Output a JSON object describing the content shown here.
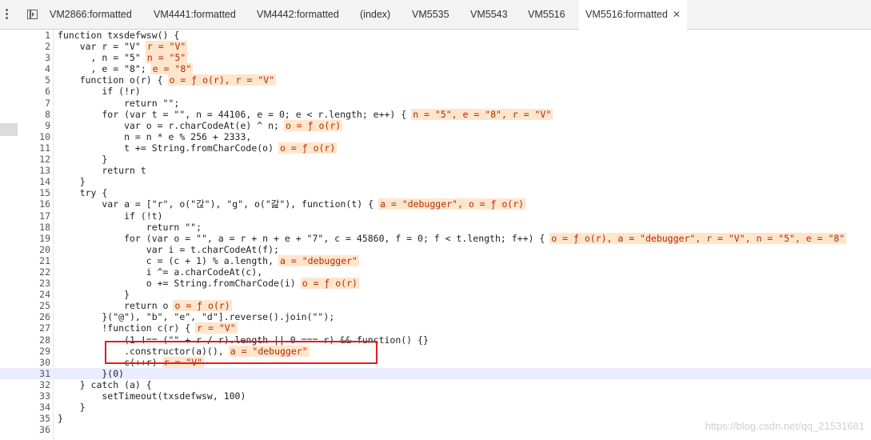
{
  "tabs": [
    {
      "label": "VM2866:formatted"
    },
    {
      "label": "VM4441:formatted"
    },
    {
      "label": "VM4442:formatted"
    },
    {
      "label": "(index)"
    },
    {
      "label": "VM5535"
    },
    {
      "label": "VM5543"
    },
    {
      "label": "VM5516"
    },
    {
      "label": "VM5516:formatted",
      "close": "✕"
    }
  ],
  "code": [
    {
      "n": "1",
      "t": "function txsdefwsw() {"
    },
    {
      "n": "2",
      "t": "    var r = \"V\"",
      "v": "r = \"V\""
    },
    {
      "n": "3",
      "t": "      , n = \"5\"",
      "v": "n = \"5\""
    },
    {
      "n": "4",
      "t": "      , e = \"8\";",
      "v": "e = \"8\""
    },
    {
      "n": "5",
      "t": "    function o(r) {",
      "v": "o = ƒ o(r), r = \"V\""
    },
    {
      "n": "6",
      "t": "        if (!r)"
    },
    {
      "n": "7",
      "t": "            return \"\";"
    },
    {
      "n": "8",
      "t": "        for (var t = \"\", n = 44106, e = 0; e < r.length; e++) {",
      "v": "n = \"5\", e = \"8\", r = \"V\""
    },
    {
      "n": "9",
      "t": "            var o = r.charCodeAt(e) ^ n;",
      "v": "o = ƒ o(r)"
    },
    {
      "n": "10",
      "t": "            n = n * e % 256 + 2333,"
    },
    {
      "n": "11",
      "t": "            t += String.fromCharCode(o)",
      "v": "o = ƒ o(r)"
    },
    {
      "n": "12",
      "t": "        }"
    },
    {
      "n": "13",
      "t": "        return t"
    },
    {
      "n": "14",
      "t": "    }"
    },
    {
      "n": "15",
      "t": "    try {"
    },
    {
      "n": "16",
      "t": "        var a = [\"r\", o(\"갅\"), \"g\", o(\"갎\"), function(t) {",
      "v": "a = \"debugger\", o = ƒ o(r)"
    },
    {
      "n": "17",
      "t": "            if (!t)"
    },
    {
      "n": "18",
      "t": "                return \"\";"
    },
    {
      "n": "19",
      "t": "            for (var o = \"\", a = r + n + e + \"7\", c = 45860, f = 0; f < t.length; f++) {",
      "v": "o = ƒ o(r), a = \"debugger\", r = \"V\", n = \"5\", e = \"8\""
    },
    {
      "n": "20",
      "t": "                var i = t.charCodeAt(f);"
    },
    {
      "n": "21",
      "t": "                c = (c + 1) % a.length,",
      "v": "a = \"debugger\""
    },
    {
      "n": "22",
      "t": "                i ^= a.charCodeAt(c),"
    },
    {
      "n": "23",
      "t": "                o += String.fromCharCode(i)",
      "v": "o = ƒ o(r)"
    },
    {
      "n": "24",
      "t": "            }"
    },
    {
      "n": "25",
      "t": "            return o",
      "v": "o = ƒ o(r)"
    },
    {
      "n": "26",
      "t": "        }(\"@\"), \"b\", \"e\", \"d\"].reverse().join(\"\");"
    },
    {
      "n": "27",
      "t": "        !function c(r) {",
      "v": "r = \"V\""
    },
    {
      "n": "28",
      "t": "            (1 !== (\"\" + r / r).length || 0 === r) && function() {}"
    },
    {
      "n": "29",
      "t": "            .constructor(a)(),",
      "v": "a = \"debugger\""
    },
    {
      "n": "30",
      "t": "            c(++r)",
      "v": "r = \"V\""
    },
    {
      "n": "31",
      "t": "        }(0)"
    },
    {
      "n": "32",
      "t": "    } catch (a) {"
    },
    {
      "n": "33",
      "t": "        setTimeout(txsdefwsw, 100)"
    },
    {
      "n": "34",
      "t": "    }"
    },
    {
      "n": "35",
      "t": "}"
    },
    {
      "n": "36",
      "t": ""
    }
  ],
  "watermark": "https://blog.csdn.net/qq_21531681"
}
